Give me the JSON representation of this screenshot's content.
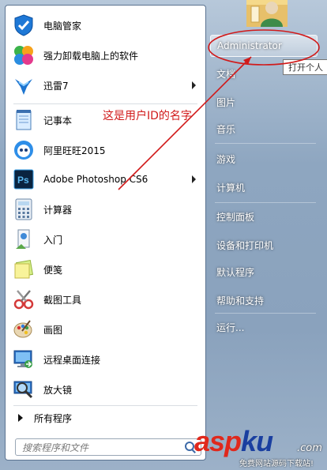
{
  "start_menu": {
    "pinned_items": [
      {
        "label": "电脑管家",
        "icon": "shield-icon"
      },
      {
        "label": "强力卸载电脑上的软件",
        "icon": "pinwheel-icon"
      },
      {
        "label": "迅雷7",
        "icon": "thunder-bird-icon"
      },
      {
        "label": "记事本",
        "icon": "notepad-icon"
      },
      {
        "label": "阿里旺旺2015",
        "icon": "wangwang-icon"
      },
      {
        "label": "Adobe Photoshop CS6",
        "icon": "photoshop-icon"
      },
      {
        "label": "计算器",
        "icon": "calculator-icon"
      },
      {
        "label": "入门",
        "icon": "getting-started-icon"
      },
      {
        "label": "便笺",
        "icon": "sticky-note-icon"
      },
      {
        "label": "截图工具",
        "icon": "scissors-icon"
      },
      {
        "label": "画图",
        "icon": "paint-palette-icon"
      },
      {
        "label": "远程桌面连接",
        "icon": "remote-desktop-icon"
      },
      {
        "label": "放大镜",
        "icon": "magnifier-icon"
      }
    ],
    "all_programs_label": "所有程序",
    "search_placeholder": "搜索程序和文件"
  },
  "right_pane": {
    "items": [
      {
        "label": "Administrator"
      },
      {
        "label": "文档"
      },
      {
        "label": "图片"
      },
      {
        "label": "音乐"
      },
      {
        "label": "游戏"
      },
      {
        "label": "计算机"
      },
      {
        "label": "控制面板"
      },
      {
        "label": "设备和打印机"
      },
      {
        "label": "默认程序"
      },
      {
        "label": "帮助和支持"
      },
      {
        "label": "运行..."
      }
    ],
    "tooltip": "打开个人"
  },
  "annotation": {
    "text": "这是用户ID的名字",
    "color": "#d11a1a"
  },
  "watermark": {
    "brand_asp": "asp",
    "brand_ku": "ku",
    "brand_com": ".com",
    "tagline": "免费网站源码下载站!"
  }
}
